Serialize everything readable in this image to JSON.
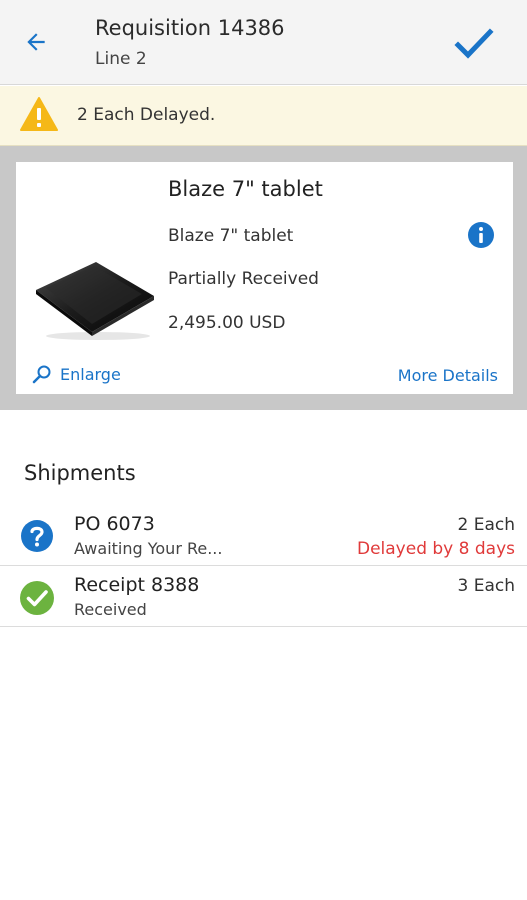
{
  "header": {
    "back_icon": "arrow-left-icon",
    "title": "Requisition 14386",
    "subtitle": "Line 2",
    "confirm_icon": "checkmark-icon"
  },
  "alert": {
    "icon": "warning-icon",
    "text": "2 Each Delayed."
  },
  "product": {
    "name": "Blaze 7\" tablet",
    "description": "Blaze 7\" tablet",
    "status": "Partially Received",
    "price": "2,495.00 USD",
    "info_icon": "info-icon",
    "enlarge_label": "Enlarge",
    "more_details_label": "More Details"
  },
  "shipments": {
    "title": "Shipments",
    "items": [
      {
        "icon": "question-icon",
        "title": "PO 6073",
        "subtitle": "Awaiting Your Re...",
        "quantity": "2 Each",
        "delay": "Delayed by 8 days"
      },
      {
        "icon": "success-check-icon",
        "title": "Receipt 8388",
        "subtitle": "Received",
        "quantity": "3 Each",
        "delay": ""
      }
    ]
  },
  "colors": {
    "accent": "#1a74c8",
    "delay": "#e03a3a",
    "success": "#6cb33f",
    "warning": "#f5b818",
    "alert_bg": "#fbf7e2"
  }
}
